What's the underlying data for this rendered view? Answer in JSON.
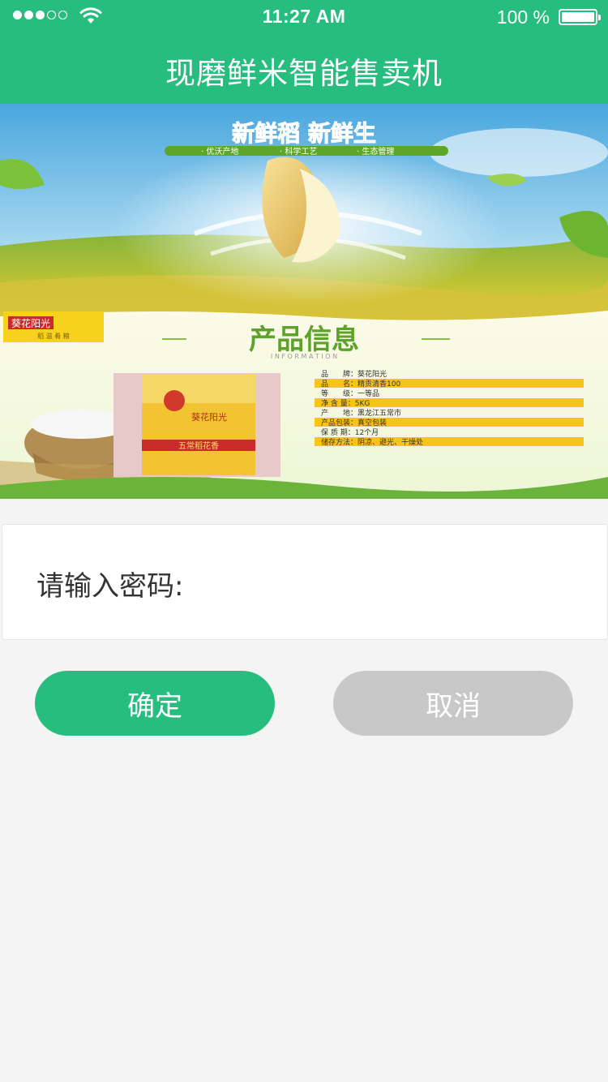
{
  "status_bar": {
    "time": "11:27 AM",
    "battery_text": "100 %",
    "signal_bars_filled": 3,
    "signal_bars_total": 5
  },
  "header": {
    "title": "现磨鲜米智能售卖机",
    "color": "#27bd7f"
  },
  "banner": {
    "slogan": "新鲜稻  新鲜生",
    "tags": [
      "· 优沃产地",
      "· 科学工艺",
      "· 生态管理"
    ],
    "brand": "葵花阳光",
    "brand_sub": "稻 滋 肴 粮",
    "section_title": "产品信息",
    "section_sub": "I N F O R M A T I O N",
    "package_top": "葵花阳光",
    "package_bottom": "五常稻花香",
    "info_rows": [
      {
        "label": "品　　牌",
        "value": "葵花阳光"
      },
      {
        "label": "品　　名",
        "value": "精贡清香100"
      },
      {
        "label": "等　　级",
        "value": "一等品"
      },
      {
        "label": "净 含 量",
        "value": "5KG"
      },
      {
        "label": "产　　地",
        "value": "黑龙江五常市"
      },
      {
        "label": "产品包装",
        "value": "真空包装"
      },
      {
        "label": "保 质 期",
        "value": "12个月"
      },
      {
        "label": "储存方法",
        "value": "阴凉、避光、干燥处"
      }
    ]
  },
  "password": {
    "label": "请输入密码:"
  },
  "buttons": {
    "confirm": "确定",
    "cancel": "取消"
  }
}
